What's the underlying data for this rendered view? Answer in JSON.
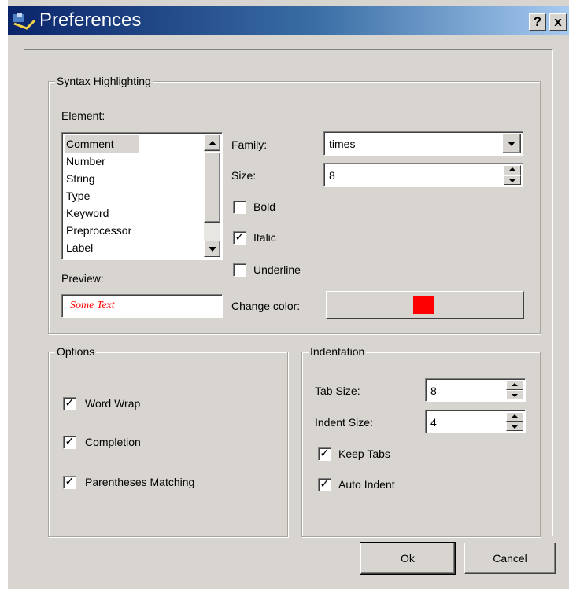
{
  "window": {
    "title": "Preferences",
    "help_button": "?",
    "close_button": "x"
  },
  "syntax": {
    "legend": "Syntax Highlighting",
    "element_label": "Element:",
    "elements": [
      "Comment",
      "Number",
      "String",
      "Type",
      "Keyword",
      "Preprocessor",
      "Label"
    ],
    "selected_element": "Comment",
    "preview_label": "Preview:",
    "preview_text": "Some Text",
    "preview_color": "#ff0000",
    "family_label": "Family:",
    "family_value": "times",
    "size_label": "Size:",
    "size_value": "8",
    "bold": {
      "label": "Bold",
      "checked": false
    },
    "italic": {
      "label": "Italic",
      "checked": true
    },
    "underline": {
      "label": "Underline",
      "checked": false
    },
    "change_color_label": "Change color:",
    "color_swatch": "#ff0000"
  },
  "options": {
    "legend": "Options",
    "word_wrap": {
      "label": "Word Wrap",
      "checked": true
    },
    "completion": {
      "label": "Completion",
      "checked": true
    },
    "paren_matching": {
      "label": "Parentheses Matching",
      "checked": true
    }
  },
  "indentation": {
    "legend": "Indentation",
    "tab_size_label": "Tab Size:",
    "tab_size_value": "8",
    "indent_size_label": "Indent Size:",
    "indent_size_value": "4",
    "keep_tabs": {
      "label": "Keep Tabs",
      "checked": true
    },
    "auto_indent": {
      "label": "Auto Indent",
      "checked": true
    }
  },
  "buttons": {
    "ok": "Ok",
    "cancel": "Cancel"
  }
}
